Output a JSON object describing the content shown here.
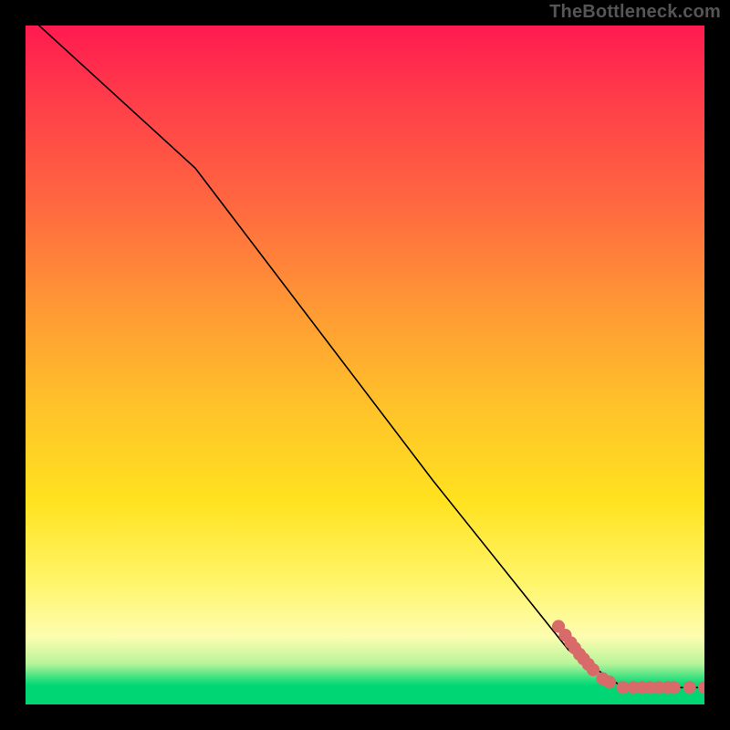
{
  "watermark": "TheBottleneck.com",
  "chart_data": {
    "type": "line",
    "title": "",
    "xlabel": "",
    "ylabel": "",
    "xlim": [
      0,
      100
    ],
    "ylim": [
      0,
      100
    ],
    "grid": false,
    "legend": false,
    "background_gradient": {
      "top_color": "#ff1a50",
      "mid_colors": [
        "#ff9a34",
        "#ffe21f",
        "#fdfdb0"
      ],
      "bottom_color": "#00d774"
    },
    "black_curve": {
      "description": "monotone decreasing curve, steep initial slope then near-linear descent to bottom-right, flattening along the x-axis at the end",
      "points_xy": [
        [
          2,
          100
        ],
        [
          25,
          79
        ],
        [
          60,
          33
        ],
        [
          80,
          8
        ],
        [
          88,
          2.5
        ],
        [
          92,
          2.5
        ],
        [
          100,
          2.5
        ]
      ]
    },
    "series": [
      {
        "name": "scatter-cluster",
        "color": "#d86a6a",
        "marker": "circle",
        "marker_radius_px": 6,
        "points_xy": [
          [
            78.5,
            11.5
          ],
          [
            79.5,
            10.2
          ],
          [
            80.3,
            9.1
          ],
          [
            80.9,
            8.3
          ],
          [
            81.6,
            7.4
          ],
          [
            82.2,
            6.7
          ],
          [
            82.9,
            5.9
          ],
          [
            83.6,
            5.1
          ],
          [
            85.0,
            3.8
          ],
          [
            86.0,
            3.3
          ],
          [
            88.0,
            2.5
          ],
          [
            89.5,
            2.5
          ],
          [
            90.8,
            2.5
          ],
          [
            92.0,
            2.5
          ],
          [
            93.3,
            2.5
          ],
          [
            94.6,
            2.5
          ],
          [
            95.5,
            2.5
          ],
          [
            97.8,
            2.5
          ],
          [
            100.0,
            2.5
          ]
        ]
      }
    ]
  }
}
